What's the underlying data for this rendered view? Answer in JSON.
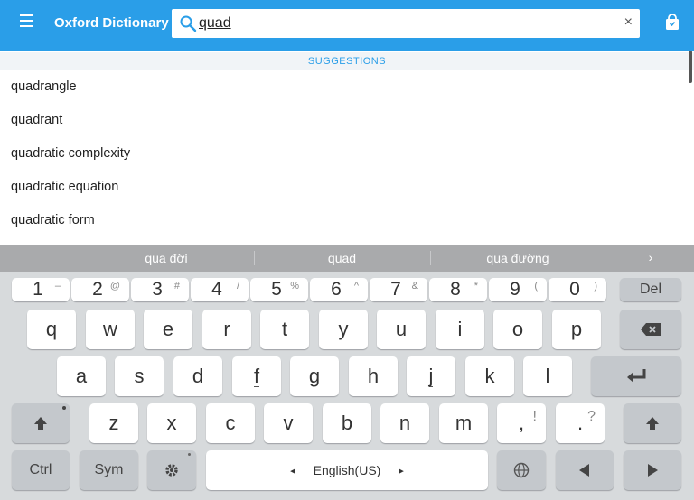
{
  "app": {
    "title": "Oxford Dictionary"
  },
  "search": {
    "value": "quad",
    "clear_label": "×"
  },
  "suggestions": {
    "header": "SUGGESTIONS",
    "items": [
      "quadrangle",
      "quadrant",
      "quadratic complexity",
      "quadratic equation",
      "quadratic form"
    ]
  },
  "predictions": [
    "qua đời",
    "quad",
    "qua đường"
  ],
  "prediction_more": "›",
  "keyboard": {
    "row1": [
      {
        "main": "1",
        "sup": "–"
      },
      {
        "main": "2",
        "sup": "@"
      },
      {
        "main": "3",
        "sup": "#"
      },
      {
        "main": "4",
        "sup": "/"
      },
      {
        "main": "5",
        "sup": "%"
      },
      {
        "main": "6",
        "sup": "^"
      },
      {
        "main": "7",
        "sup": "&"
      },
      {
        "main": "8",
        "sup": "*"
      },
      {
        "main": "9",
        "sup": "("
      },
      {
        "main": "0",
        "sup": ")"
      }
    ],
    "del": "Del",
    "row2": [
      "q",
      "w",
      "e",
      "r",
      "t",
      "y",
      "u",
      "i",
      "o",
      "p"
    ],
    "row3": [
      "a",
      "s",
      "d",
      "f",
      "g",
      "h",
      "j",
      "k",
      "l"
    ],
    "row4": [
      "z",
      "x",
      "c",
      "v",
      "b",
      "n",
      "m"
    ],
    "comma": {
      "main": ",",
      "sup": "!"
    },
    "period": {
      "main": ".",
      "sup": "?"
    },
    "ctrl": "Ctrl",
    "sym": "Sym",
    "language": "English(US)",
    "space_left_arrow": "◂",
    "space_right_arrow": "▸"
  },
  "colors": {
    "accent": "#2a9ee8",
    "prediction_bar": "#a9aaac",
    "keyboard_bg": "#d7dadc"
  },
  "icons": [
    "menu-icon",
    "search-icon",
    "clear-icon",
    "bag-icon",
    "backspace-icon",
    "enter-icon",
    "shift-icon",
    "settings-icon",
    "globe-icon",
    "arrow-left-icon",
    "arrow-right-icon"
  ]
}
